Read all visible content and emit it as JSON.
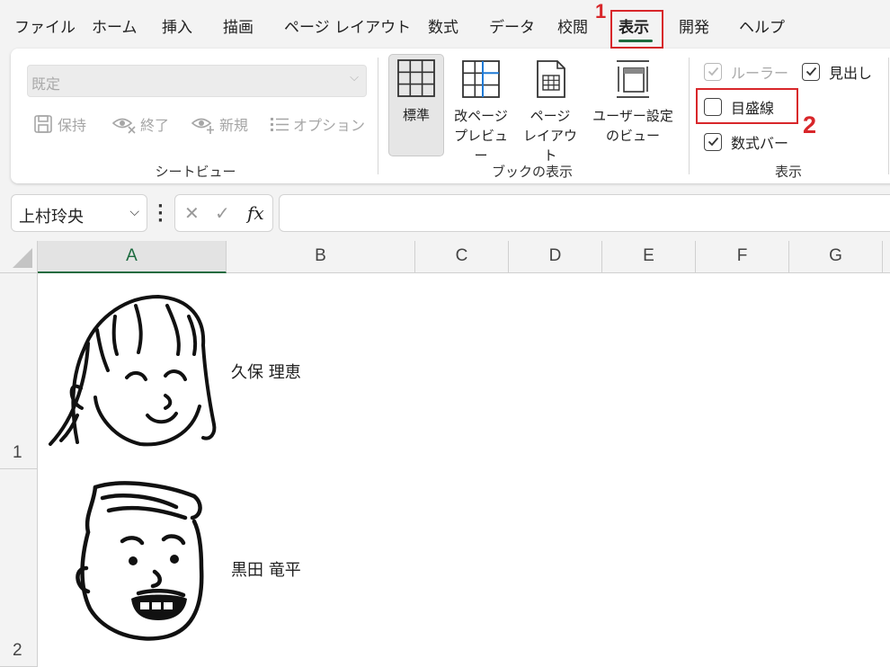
{
  "menu": {
    "tabs": [
      "ファイル",
      "ホーム",
      "挿入",
      "描画",
      "ページ レイアウト",
      "数式",
      "データ",
      "校閲",
      "表示",
      "開発",
      "ヘルプ"
    ],
    "active_tab": "表示"
  },
  "annotations": {
    "step1": "1",
    "step2": "2"
  },
  "sheet_view": {
    "select_value": "既定",
    "buttons": [
      "保持",
      "終了",
      "新規",
      "オプション"
    ],
    "group_label": "シートビュー"
  },
  "workbook_views": {
    "buttons": [
      {
        "line1": "標準",
        "line2": ""
      },
      {
        "line1": "改ページ",
        "line2": "プレビュー"
      },
      {
        "line1": "ページ",
        "line2": "レイアウト"
      },
      {
        "line1": "ユーザー設定",
        "line2": "のビュー"
      }
    ],
    "group_label": "ブックの表示"
  },
  "show": {
    "ruler": {
      "label": "ルーラー",
      "checked": true,
      "enabled": false
    },
    "headings": {
      "label": "見出し",
      "checked": true
    },
    "gridlines": {
      "label": "目盛線",
      "checked": false
    },
    "formula_bar": {
      "label": "数式バー",
      "checked": true
    },
    "group_label": "表示"
  },
  "formula_bar": {
    "name_box": "上村玲央",
    "fx_label": "fx",
    "formula": ""
  },
  "sheet": {
    "columns": [
      "A",
      "B",
      "C",
      "D",
      "E",
      "F",
      "G"
    ],
    "selected_column": "A",
    "rows": [
      "1",
      "2"
    ],
    "cells": {
      "B1": "久保 理恵",
      "B2": "黒田 竜平"
    }
  },
  "colors": {
    "accent": "#1d6b3f",
    "annotation": "#d8262a"
  }
}
